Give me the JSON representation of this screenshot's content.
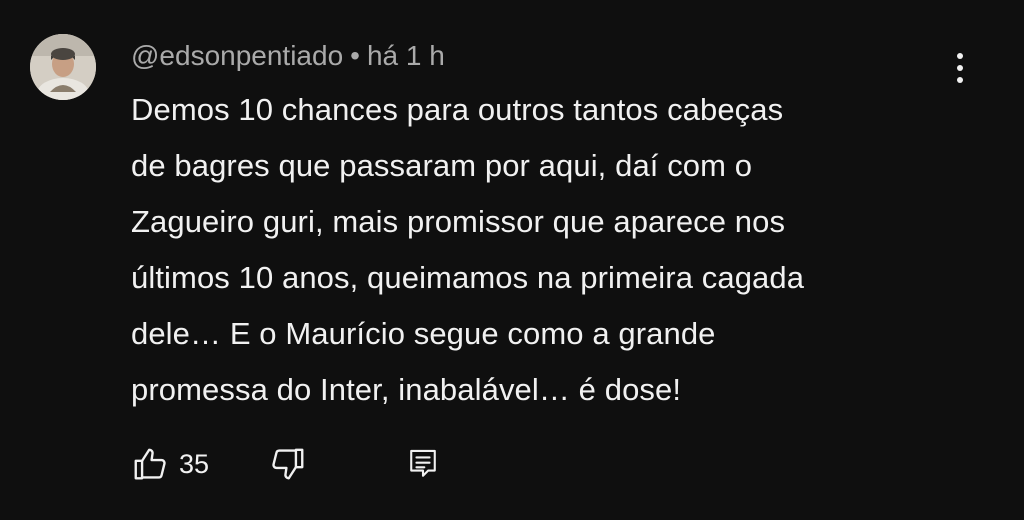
{
  "comment": {
    "author": "@edsonpentiado",
    "separator": "•",
    "timestamp": "há 1 h",
    "text": "Demos 10 chances para outros tantos cabeças\nde bagres que passaram por aqui, daí com o\nZagueiro guri, mais promissor que aparece nos\núltimos 10 anos, queimamos na primeira cagada\ndele… E o Maurício segue como a grande\npromessa do Inter, inabalável… é dose!",
    "like_count": "35"
  },
  "icons": {
    "avatar": "avatar-photo",
    "menu": "more-vertical-icon",
    "like": "thumbs-up-icon",
    "dislike": "thumbs-down-icon",
    "reply": "reply-comment-icon"
  },
  "colors": {
    "background": "#0f0f0f",
    "text_primary": "#f1f1f1",
    "text_secondary": "#aaaaaa"
  }
}
